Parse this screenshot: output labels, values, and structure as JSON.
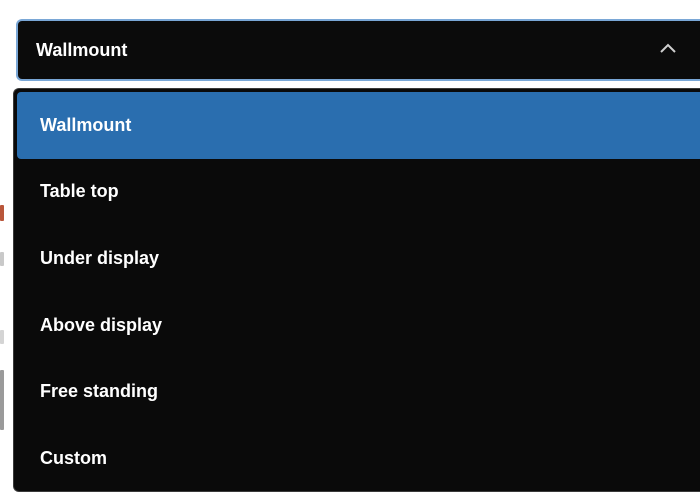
{
  "select": {
    "value": "Wallmount",
    "icon": "chevron-up-icon",
    "border_color": "#7aa7d6"
  },
  "menu": {
    "selected_index": 0,
    "selected_color": "#2a6eaf",
    "options": [
      {
        "label": "Wallmount"
      },
      {
        "label": "Table top"
      },
      {
        "label": "Under display"
      },
      {
        "label": "Above display"
      },
      {
        "label": "Free standing"
      },
      {
        "label": "Custom"
      }
    ]
  }
}
